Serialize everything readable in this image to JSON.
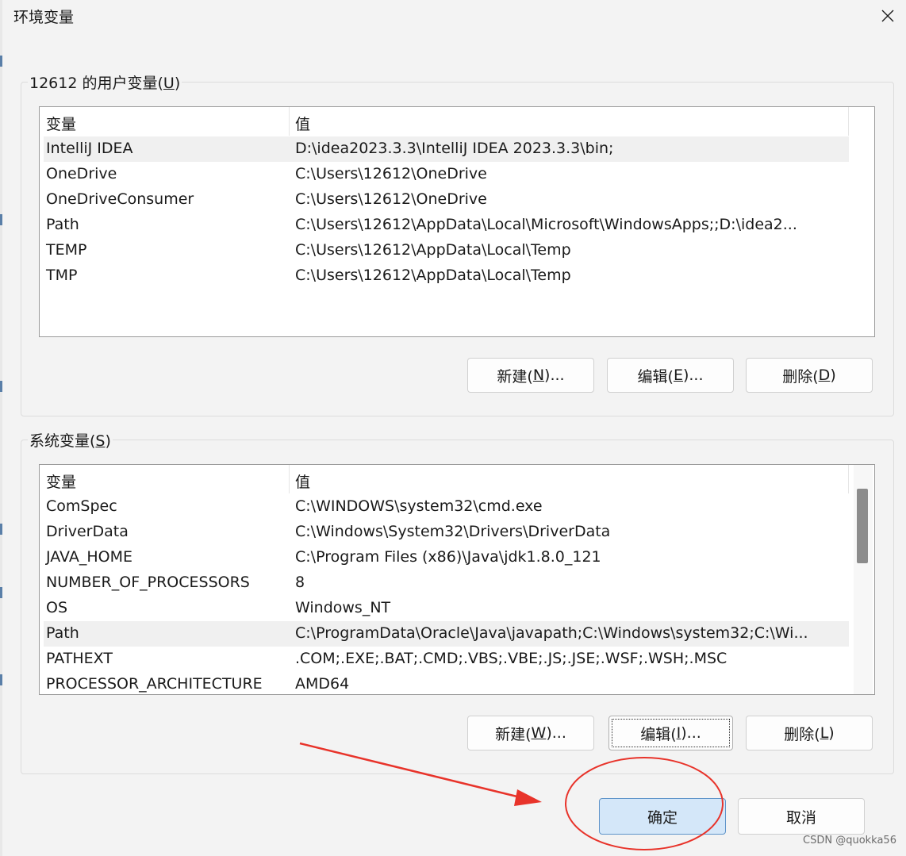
{
  "window": {
    "title": "环境变量",
    "close_icon": "close-icon"
  },
  "user_vars": {
    "label_prefix": "12612 的用户变量(",
    "label_key": "U",
    "label_suffix": ")",
    "col_name": "变量",
    "col_value": "值",
    "rows": [
      {
        "name": "IntelliJ IDEA",
        "value": "D:\\idea2023.3.3\\IntelliJ IDEA 2023.3.3\\bin;",
        "selected": true
      },
      {
        "name": "OneDrive",
        "value": "C:\\Users\\12612\\OneDrive"
      },
      {
        "name": "OneDriveConsumer",
        "value": "C:\\Users\\12612\\OneDrive"
      },
      {
        "name": "Path",
        "value": "C:\\Users\\12612\\AppData\\Local\\Microsoft\\WindowsApps;;D:\\idea2..."
      },
      {
        "name": "TEMP",
        "value": "C:\\Users\\12612\\AppData\\Local\\Temp"
      },
      {
        "name": "TMP",
        "value": "C:\\Users\\12612\\AppData\\Local\\Temp"
      }
    ],
    "buttons": {
      "new": {
        "prefix": "新建(",
        "key": "N",
        "suffix": ")..."
      },
      "edit": {
        "prefix": "编辑(",
        "key": "E",
        "suffix": ")..."
      },
      "delete": {
        "prefix": "删除(",
        "key": "D",
        "suffix": ")"
      }
    }
  },
  "system_vars": {
    "label_prefix": "系统变量(",
    "label_key": "S",
    "label_suffix": ")",
    "col_name": "变量",
    "col_value": "值",
    "rows": [
      {
        "name": "ComSpec",
        "value": "C:\\WINDOWS\\system32\\cmd.exe"
      },
      {
        "name": "DriverData",
        "value": "C:\\Windows\\System32\\Drivers\\DriverData"
      },
      {
        "name": "JAVA_HOME",
        "value": "C:\\Program Files (x86)\\Java\\jdk1.8.0_121"
      },
      {
        "name": "NUMBER_OF_PROCESSORS",
        "value": "8"
      },
      {
        "name": "OS",
        "value": "Windows_NT"
      },
      {
        "name": "Path",
        "value": "C:\\ProgramData\\Oracle\\Java\\javapath;C:\\Windows\\system32;C:\\Wi...",
        "selected": true
      },
      {
        "name": "PATHEXT",
        "value": ".COM;.EXE;.BAT;.CMD;.VBS;.VBE;.JS;.JSE;.WSF;.WSH;.MSC"
      },
      {
        "name": "PROCESSOR_ARCHITECTURE",
        "value": "AMD64"
      }
    ],
    "buttons": {
      "new": {
        "prefix": "新建(",
        "key": "W",
        "suffix": ")..."
      },
      "edit": {
        "prefix": "编辑(",
        "key": "I",
        "suffix": ")..."
      },
      "delete": {
        "prefix": "删除(",
        "key": "L",
        "suffix": ")"
      }
    }
  },
  "footer": {
    "ok": "确定",
    "cancel": "取消"
  },
  "watermark": "CSDN @quokka56",
  "colors": {
    "annotation": "#e8332a",
    "primary_bg": "#d4e7f9",
    "selection": "#f0f0f0"
  }
}
